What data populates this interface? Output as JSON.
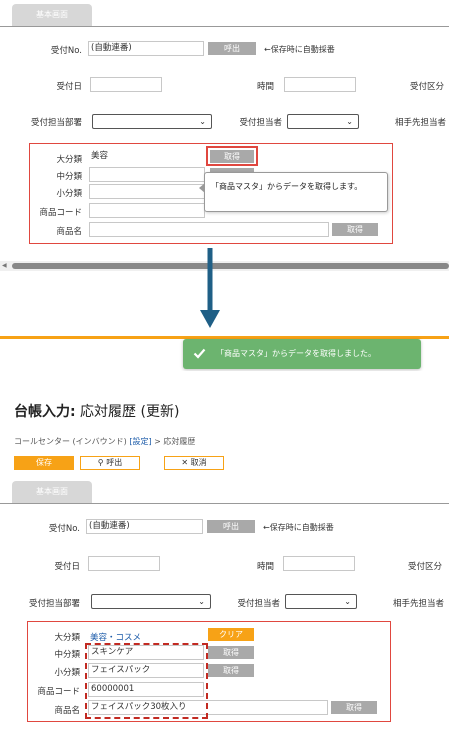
{
  "top": {
    "tab_label": "基本画面",
    "reception_no_label": "受付No.",
    "reception_no_value": "(自動連番)",
    "call_button": "呼出",
    "auto_number_note": "←保存時に自動採番",
    "reception_date_label": "受付日",
    "time_label": "時間",
    "reception_type_label": "受付区分",
    "department_label": "受付担当部署",
    "staff_label": "受付担当者",
    "counterpart_label": "相手先担当者",
    "major_label": "大分類",
    "major_value": "美容",
    "fetch_button": "取得",
    "middle_label": "中分類",
    "minor_label": "小分類",
    "product_code_label": "商品コード",
    "product_name_label": "商品名",
    "tooltip_text": "「商品マスタ」からデータを取得します。"
  },
  "toast": {
    "message": "「商品マスタ」からデータを取得しました。"
  },
  "bottom": {
    "page_title_prefix": "台帳入力:",
    "page_title_rest": " 応対履歴 (更新)",
    "breadcrumb_section": "コールセンター (インバウンド)",
    "breadcrumb_settings": "[設定]",
    "breadcrumb_current": "> 応対履歴",
    "save_button": "保存",
    "call_button": "呼出",
    "cancel_button": "取消",
    "tab_label": "基本画面",
    "reception_no_label": "受付No.",
    "reception_no_value": "(自動連番)",
    "call_button_2": "呼出",
    "auto_number_note": "←保存時に自動採番",
    "reception_date_label": "受付日",
    "time_label": "時間",
    "reception_type_label": "受付区分",
    "department_label": "受付担当部署",
    "staff_label": "受付担当者",
    "counterpart_label": "相手先担当者",
    "major_label": "大分類",
    "major_value": "美容・コスメ",
    "clear_button": "クリア",
    "middle_label": "中分類",
    "middle_value": "スキンケア",
    "fetch_button": "取得",
    "minor_label": "小分類",
    "minor_value": "フェイスパック",
    "product_code_label": "商品コード",
    "product_code_value": "60000001",
    "product_name_label": "商品名",
    "product_name_value": "フェイスパック30枚入り"
  },
  "colors": {
    "accent_orange": "#f7a216",
    "toast_green": "#6cb46f",
    "highlight_red": "#e0473f",
    "arrow_blue": "#1f5f86",
    "link_blue": "#1a5aa8"
  }
}
